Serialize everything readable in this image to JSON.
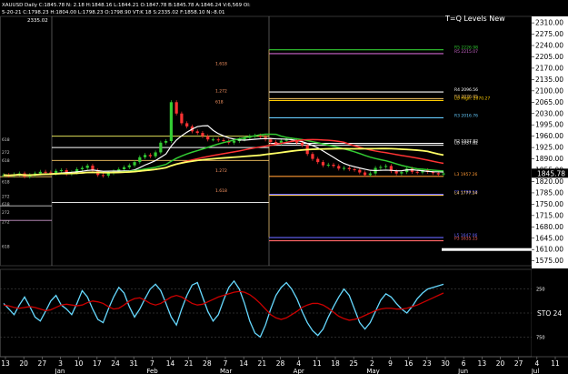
{
  "header": {
    "info_line1": "XAUUSD Daily  C:1845.78  N:  2.18  H:1848.16  L:1844.21  O:1847.78  B:1845.78  A:1846.24  V:6,569  OI:",
    "info_line2": "5-20-21  C:1798.23  H:1804.00  L:1798.23  O:1798.90  VT:K 18  S:2335.02  F:1858.10  N:-8.01",
    "high_value": "2335.02",
    "title": "T=Q Levels New"
  },
  "colors": {
    "background": "#000000",
    "price_axis_bg": "#ffffff",
    "price_axis_text": "#000000",
    "grid": "#3a3a3a",
    "stochastic_k": "#66d9ff",
    "stochastic_d": "#cc0000"
  },
  "chart_data": [
    {
      "type": "line",
      "name": "price-panel",
      "y_axis_ticks": [
        "2310.00",
        "2275.00",
        "2240.00",
        "2205.00",
        "2170.00",
        "2135.00",
        "2100.00",
        "2065.00",
        "2030.00",
        "1995.00",
        "1960.00",
        "1925.00",
        "1890.00",
        "1855.00",
        "1820.00",
        "1785.00",
        "1750.00",
        "1715.00",
        "1680.00",
        "1645.00",
        "1610.00",
        "1575.00"
      ],
      "ylim": [
        1560,
        2330
      ],
      "current_price": "1845.78",
      "levels": [
        {
          "label": "R5 2226.98",
          "value": 2226.98,
          "color": "#33cc33"
        },
        {
          "label": "R5 2215.07",
          "value": 2215.07,
          "color": "#cc66cc"
        },
        {
          "label": "R4 2096.56",
          "value": 2096.56,
          "color": "#ffffff"
        },
        {
          "label": "R3 2076.05",
          "value": 2076.05,
          "color": "#ffcc66"
        },
        {
          "label": "LO High: 2070.27",
          "value": 2070.27,
          "color": "#ffcc00"
        },
        {
          "label": "R3 2016.76",
          "value": 2016.76,
          "color": "#66ccff"
        },
        {
          "label": "R2 1937.82",
          "value": 1937.82,
          "color": "#ffffff"
        },
        {
          "label": "LO 1937.82",
          "value": 1932.0,
          "color": "#ffffff"
        },
        {
          "label": "L3 1957.26",
          "value": 1836.0,
          "color": "#ff9933"
        },
        {
          "label": "P1 1780.58",
          "value": 1780.58,
          "color": "#6666ff"
        },
        {
          "label": "L4 1777.54",
          "value": 1777.54,
          "color": "#ffcc66"
        },
        {
          "label": "L5 1647.06",
          "value": 1647.06,
          "color": "#6666ff"
        },
        {
          "label": "P3 1635.15",
          "value": 1637.0,
          "color": "#ff6666"
        }
      ],
      "fib_labels": [
        "1.618",
        "1.272",
        "618",
        "1.272",
        "1.618"
      ],
      "left_labels": [
        "618",
        "272",
        "618",
        "618",
        "272",
        "618",
        "272",
        "272",
        "618"
      ],
      "x_ticks": [
        "13",
        "20",
        "27",
        "3",
        "10",
        "17",
        "24",
        "31",
        "7",
        "14",
        "21",
        "28",
        "7",
        "14",
        "21",
        "28",
        "4",
        "11",
        "18",
        "25",
        "2",
        "9",
        "16",
        "23",
        "30",
        "6",
        "13",
        "20",
        "27",
        "4",
        "11"
      ],
      "month_labels": [
        "Jan",
        "Feb",
        "Mar",
        "Apr",
        "May",
        "Jun",
        "Jul"
      ],
      "close_series": [
        1840,
        1838,
        1842,
        1845,
        1835,
        1840,
        1845,
        1850,
        1848,
        1845,
        1853,
        1855,
        1843,
        1848,
        1858,
        1862,
        1869,
        1855,
        1840,
        1838,
        1846,
        1852,
        1858,
        1864,
        1870,
        1880,
        1895,
        1902,
        1898,
        1910,
        1940,
        1945,
        2065,
        2030,
        2000,
        1990,
        1975,
        1970,
        1960,
        1950,
        1950,
        1948,
        1945,
        1940,
        1945,
        1950,
        1955,
        1960,
        1962,
        1958,
        1950,
        1942,
        1938,
        1946,
        1950,
        1948,
        1940,
        1932,
        1905,
        1890,
        1880,
        1870,
        1872,
        1868,
        1860,
        1862,
        1858,
        1856,
        1848,
        1840,
        1845,
        1862,
        1865,
        1868,
        1852,
        1845,
        1849,
        1860,
        1850,
        1848,
        1855,
        1850,
        1846,
        1842,
        1845
      ]
    },
    {
      "type": "line",
      "name": "stochastic",
      "label": "STO 24",
      "y_axis_ticks": [
        "250",
        "750"
      ],
      "series": [
        {
          "values": [
            62,
            55,
            48,
            60,
            70,
            58,
            45,
            40,
            52,
            65,
            72,
            60,
            55,
            48,
            62,
            78,
            70,
            55,
            42,
            38,
            55,
            70,
            82,
            75,
            58,
            45,
            55,
            68,
            80,
            86,
            78,
            62,
            45,
            35,
            55,
            72,
            85,
            88,
            70,
            52,
            40,
            48,
            66,
            82,
            90,
            80,
            62,
            40,
            25,
            20,
            35,
            55,
            72,
            82,
            88,
            80,
            68,
            52,
            38,
            28,
            22,
            30,
            45,
            58,
            70,
            80,
            72,
            55,
            38,
            30,
            38,
            52,
            66,
            74,
            70,
            62,
            55,
            50,
            58,
            68,
            75,
            80,
            82,
            84,
            86
          ]
        },
        {
          "values": [
            60,
            59,
            57,
            56,
            57,
            58,
            57,
            55,
            53,
            54,
            57,
            60,
            61,
            60,
            59,
            60,
            63,
            65,
            64,
            62,
            58,
            55,
            56,
            60,
            65,
            68,
            69,
            66,
            62,
            60,
            62,
            66,
            70,
            72,
            70,
            66,
            62,
            60,
            61,
            64,
            67,
            70,
            72,
            74,
            76,
            77,
            76,
            73,
            68,
            62,
            55,
            48,
            44,
            42,
            44,
            48,
            52,
            57,
            60,
            62,
            62,
            60,
            56,
            51,
            46,
            43,
            41,
            42,
            44,
            47,
            50,
            53,
            55,
            56,
            56,
            55,
            55,
            56,
            58,
            60,
            63,
            66,
            69,
            72,
            75
          ]
        }
      ]
    }
  ]
}
